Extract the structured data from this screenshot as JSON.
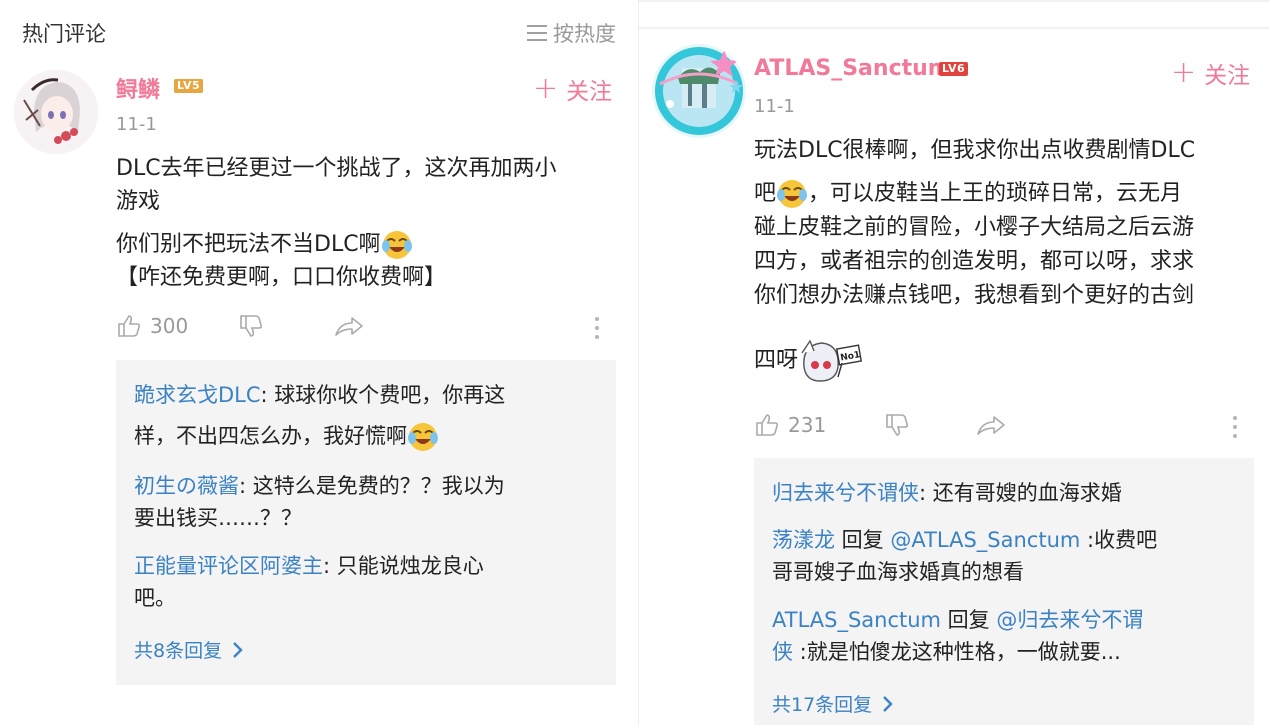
{
  "left": {
    "section_title": "热门评论",
    "sort_label": "按热度",
    "comment": {
      "username": "鲟鳞",
      "level": "LV5",
      "follow_label": "关注",
      "date": "11-1",
      "text_line1": "DLC去年已经更过一个挑战了，这次再加两小",
      "text_line2": "游戏",
      "text_line3": "你们别不把玩法不当DLC啊",
      "text_line4": "【咋还免费更啊，口口你收费啊】",
      "likes": "300"
    },
    "replies": [
      {
        "author": "跪求玄戈DLC",
        "text_a": ": 球球你收个费吧，你再这",
        "text_b": "样，不出四怎么办，我好慌啊"
      },
      {
        "author": "初生の薇酱",
        "text_a": ": 这特么是免费的？？我以为",
        "text_b": "要出钱买……？？"
      },
      {
        "author": "正能量评论区阿婆主",
        "text_a": ": 只能说烛龙良心",
        "text_b": "吧。"
      }
    ],
    "more_replies": "共8条回复"
  },
  "right": {
    "comment": {
      "username": "ATLAS_Sanctum",
      "level": "LV6",
      "follow_label": "关注",
      "date": "11-1",
      "line1": "玩法DLC很棒啊，但我求你出点收费剧情DLC",
      "line2a": "吧",
      "line2b": "，可以皮鞋当上王的琐碎日常，云无月",
      "line3": "碰上皮鞋之前的冒险，小樱子大结局之后云游",
      "line4": "四方，或者祖宗的创造发明，都可以呀，求求",
      "line5": "你们想办法赚点钱吧，我想看到个更好的古剑",
      "line6": "四呀",
      "sticker_text": "No1",
      "likes": "231"
    },
    "replies": [
      {
        "author": "归去来兮不谓侠",
        "text": ": 还有哥嫂的血海求婚"
      },
      {
        "author": "荡漾龙",
        "reply_word": " 回复 ",
        "mention": "@ATLAS_Sanctum",
        "text_a": " :收费吧",
        "text_b": "哥哥嫂子血海求婚真的想看"
      },
      {
        "author": "ATLAS_Sanctum",
        "reply_word": " 回复 ",
        "mention_a": "@归去来兮不谓",
        "mention_b": "侠",
        "text_b": " :就是怕傻龙这种性格，一做就要..."
      }
    ],
    "more_replies": "共17条回复"
  },
  "colors": {
    "username_pink": "#f27a99",
    "link_blue": "#3b82c4",
    "muted_gray": "#999999",
    "reply_bg": "#f4f4f4",
    "lv5_badge": "#e8a640",
    "lv6_badge": "#e0433b"
  },
  "icons": [
    "sort-lines-icon",
    "plus-icon",
    "thumb-up-icon",
    "thumb-down-icon",
    "share-arrow-icon",
    "more-vertical-icon",
    "chevron-right-icon",
    "laugh-cry-emoji-icon",
    "chibi-no1-sticker-icon"
  ]
}
